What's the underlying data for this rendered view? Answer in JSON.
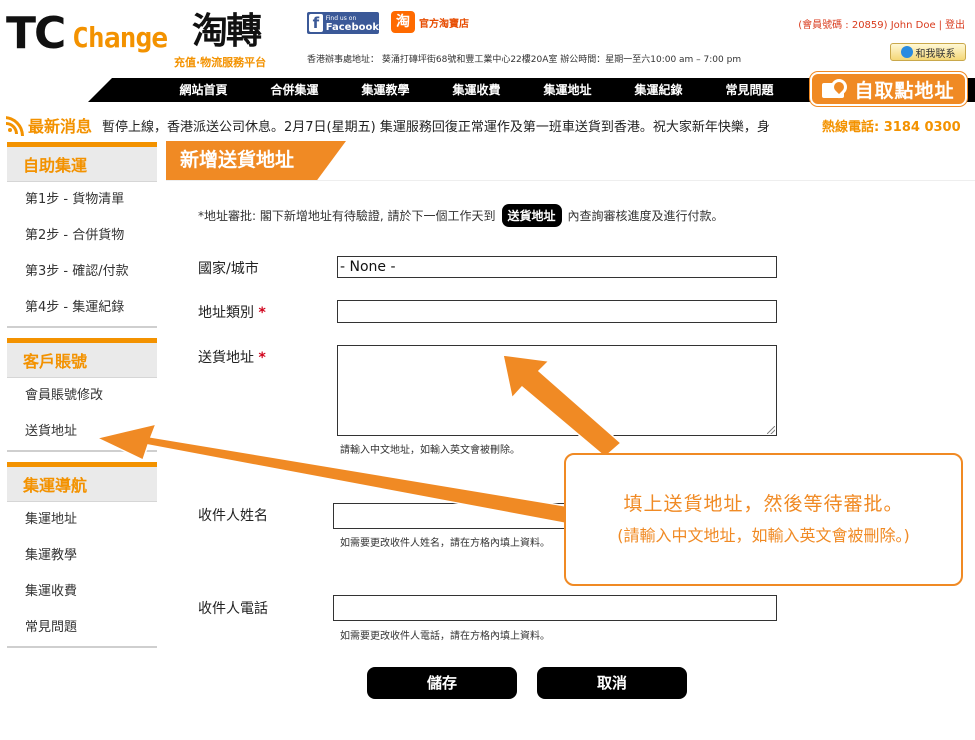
{
  "header": {
    "logo": {
      "tc": "TC",
      "change": "Change",
      "cn": "淘轉",
      "subtitle": "充值·物流服務平台"
    },
    "facebook": {
      "small": "Find us on",
      "big": "Facebook"
    },
    "taobao": {
      "icon": "淘",
      "label": "官方淘寶店"
    },
    "office_info": "香港辦事處地址： 葵涌打磚坪街68號和豐工業中心22樓20A室 辦公時間：星期一至六10:00 am – 7:00 pm",
    "member": {
      "info": "(會員號碼 : 20859) John Doe",
      "sep": "|",
      "logout": "登出"
    },
    "contact_button": "和我联系"
  },
  "nav": {
    "items": [
      {
        "label": "網站首頁"
      },
      {
        "label": "合併集運"
      },
      {
        "label": "集運教學"
      },
      {
        "label": "集運收費"
      },
      {
        "label": "集運地址"
      },
      {
        "label": "集運紀錄"
      },
      {
        "label": "常見問題"
      }
    ],
    "pickup": "自取點地址"
  },
  "ticker": {
    "title": "最新消息",
    "text": "暫停上線，香港派送公司休息。2月7日(星期五) 集運服務回復正常運作及第一班車送貨到香港。祝大家新年快樂，身",
    "hotline": "熱線電話: 3184 0300"
  },
  "sidebar": {
    "sections": [
      {
        "title": "自助集運",
        "items": [
          "第1步 - 貨物清單",
          "第2步 - 合併貨物",
          "第3步 - 確認/付款",
          "第4步 - 集運紀錄"
        ]
      },
      {
        "title": "客戶賬號",
        "items": [
          "會員賬號修改",
          "送貨地址"
        ]
      },
      {
        "title": "集運導航",
        "items": [
          "集運地址",
          "集運教學",
          "集運收費",
          "常見問題"
        ]
      }
    ]
  },
  "main": {
    "title": "新增送貨地址",
    "notice": {
      "before": "*地址審批: 閣下新增地址有待驗證, 請於下一個工作天到",
      "pill": "送貨地址",
      "after": "內查詢審核進度及進行付款。"
    },
    "fields": {
      "country": {
        "label": "國家/城市",
        "value": "- None -"
      },
      "type": {
        "label": "地址類別",
        "required": "*"
      },
      "address": {
        "label": "送貨地址",
        "required": "*",
        "help": "請輸入中文地址，如輸入英文會被刪除。"
      },
      "name": {
        "label": "收件人姓名",
        "help": "如需要更改收件人姓名，請在方格內填上資料。"
      },
      "phone": {
        "label": "收件人電話",
        "help": "如需要更改收件人電話，請在方格內填上資料。"
      }
    },
    "save": "儲存",
    "cancel": "取消"
  },
  "callout": {
    "line1": "填上送貨地址，然後等待審批。",
    "line2": "(請輸入中文地址，如輸入英文會被刪除。)"
  },
  "colors": {
    "accent": "#f08a24",
    "nav": "#000000",
    "required": "#d0021b"
  }
}
